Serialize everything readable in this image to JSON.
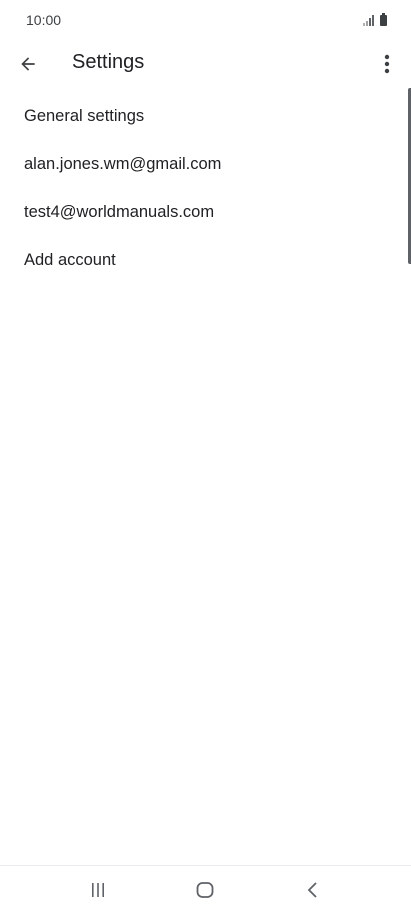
{
  "status_bar": {
    "time": "10:00",
    "icons": [
      "signal-icon",
      "battery-icon"
    ]
  },
  "app_bar": {
    "back_icon": "arrow-back-icon",
    "title": "Settings",
    "more_icon": "more-vert-icon"
  },
  "settings_list": {
    "items": [
      {
        "label": "General settings"
      },
      {
        "label": "alan.jones.wm@gmail.com"
      },
      {
        "label": "test4@worldmanuals.com"
      },
      {
        "label": "Add account"
      }
    ]
  },
  "nav_bar": {
    "recents_icon": "recents-icon",
    "home_icon": "home-icon",
    "back_icon": "back-icon"
  },
  "colors": {
    "text_primary": "#202124",
    "icon": "#5f6368",
    "background": "#ffffff"
  }
}
